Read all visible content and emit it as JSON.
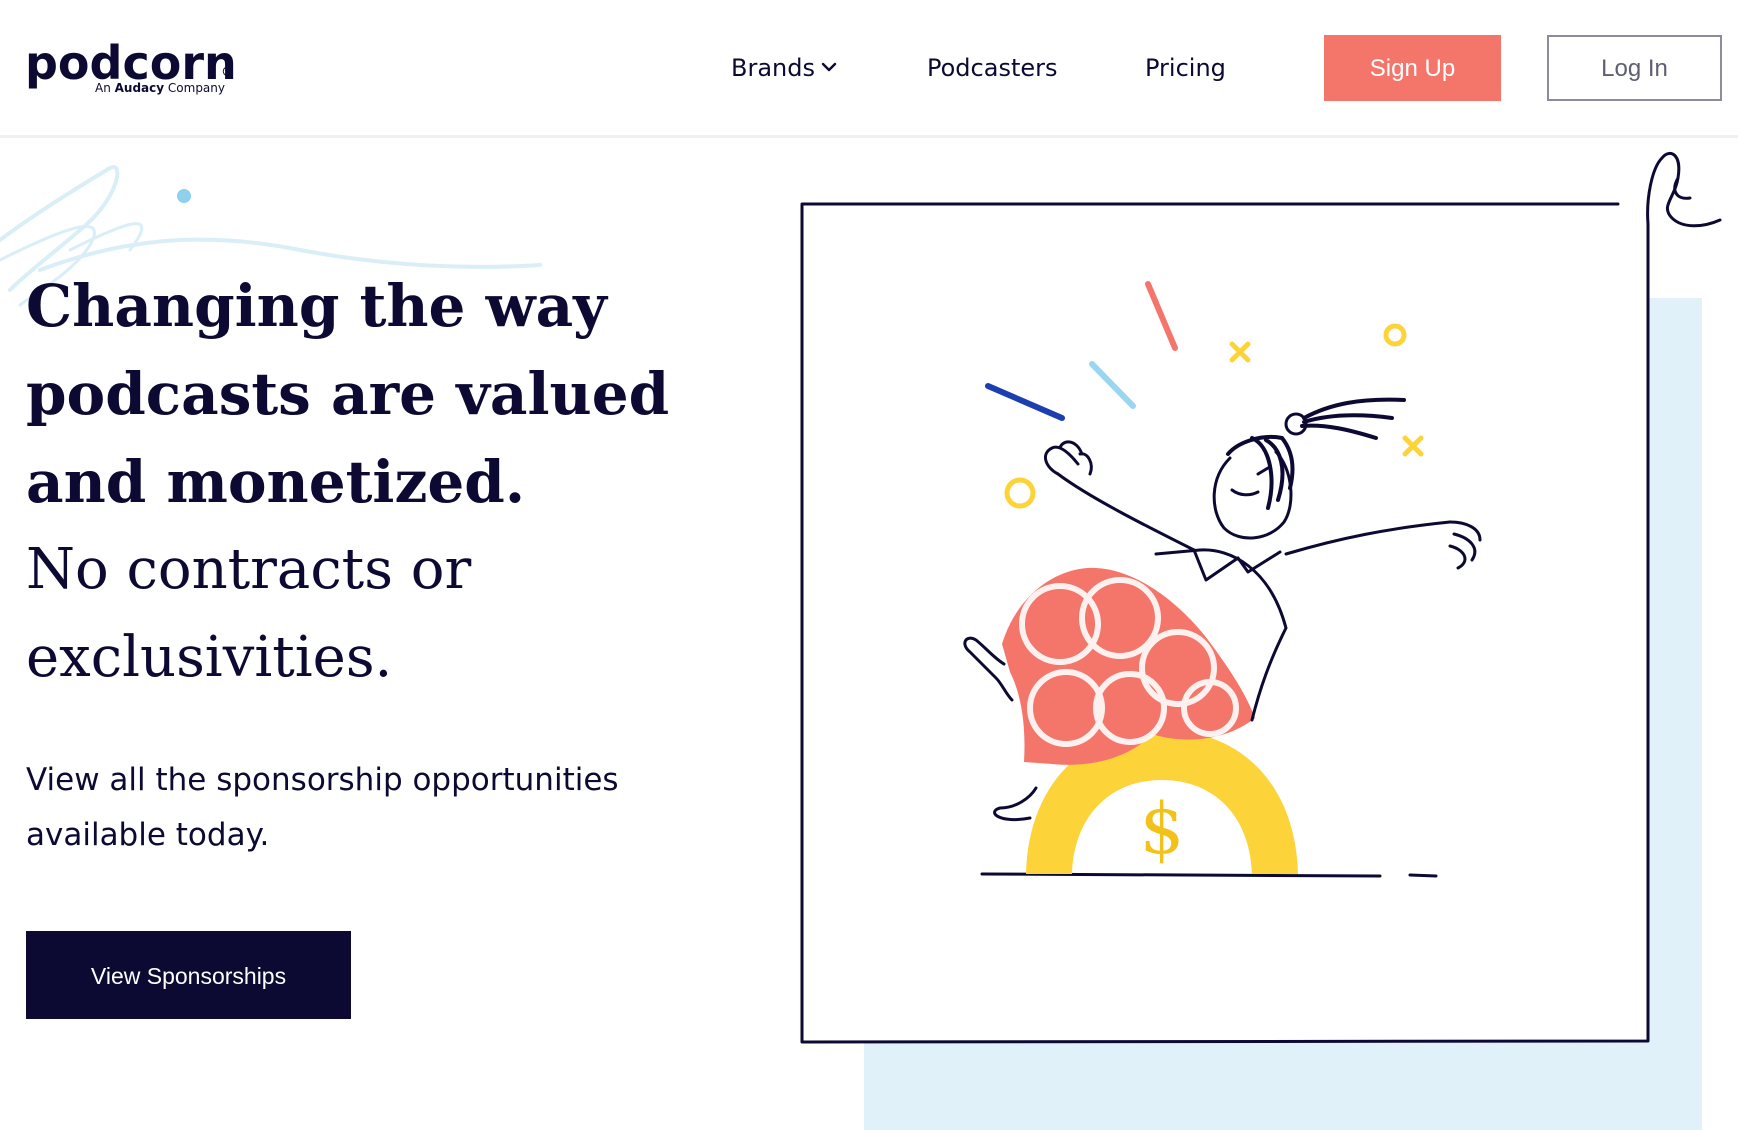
{
  "header": {
    "logo": {
      "wordmark": "podcorn",
      "registered": "®",
      "tagline_prefix": "An ",
      "tagline_brand": "Audacy",
      "tagline_suffix": " Company"
    },
    "nav": {
      "brands": "Brands",
      "podcasters": "Podcasters",
      "pricing": "Pricing"
    },
    "signup_label": "Sign Up",
    "login_label": "Log In"
  },
  "hero": {
    "title_line1": "Changing the way",
    "title_line2": "podcasts are valued",
    "title_line3": "and monetized.",
    "subtitle_line1": "No contracts or",
    "subtitle_line2": "exclusivities.",
    "body_line1": "View all the sponsorship opportunities",
    "body_line2": "available today.",
    "cta_label": "View Sponsorships"
  },
  "illustration": {
    "coin_symbol": "$",
    "colors": {
      "navy": "#0c0a33",
      "coral": "#f4756a",
      "yellow": "#fdd33a",
      "light_blue": "#e1f1f9",
      "sky": "#9ad6f0",
      "blue": "#1b3fb0"
    }
  },
  "colors": {
    "brand_navy": "#0c0a33",
    "signup_coral": "#f4756a",
    "login_border": "#8d8c9a"
  }
}
